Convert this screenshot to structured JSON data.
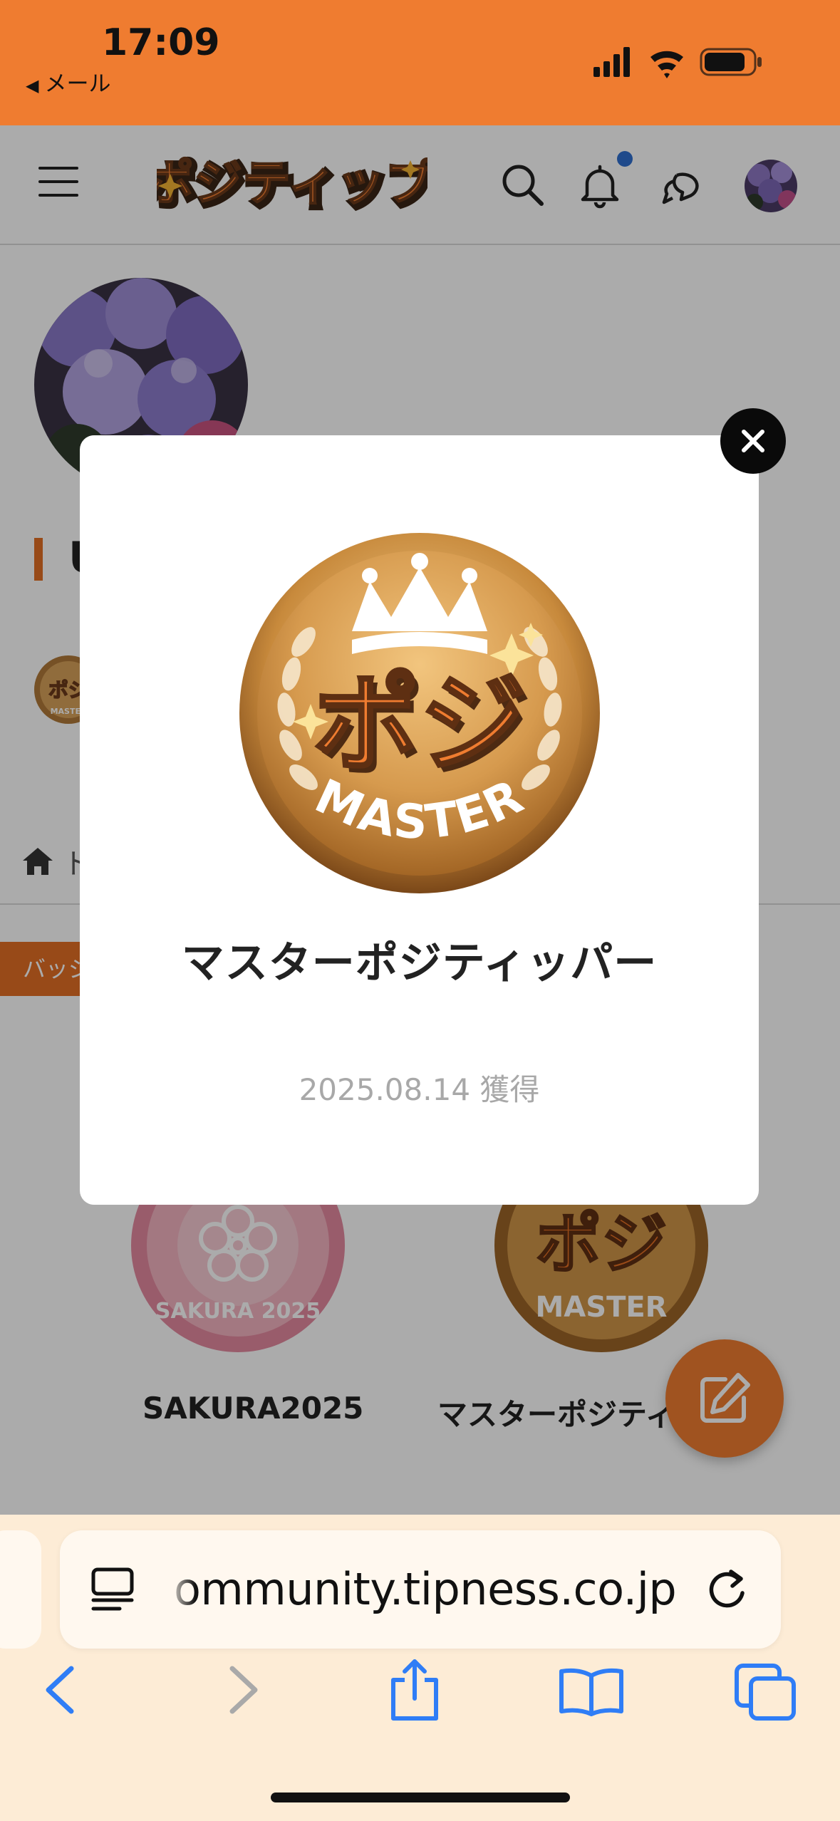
{
  "status_bar": {
    "time": "17:09",
    "back_label": "メール",
    "back_glyph": "◀",
    "icons": [
      "signal-icon",
      "wifi-icon",
      "battery-icon"
    ],
    "color": "#ef7c30"
  },
  "header": {
    "logo_text": "ポジティップ",
    "icons": [
      "menu-icon",
      "search-icon",
      "bell-icon",
      "chat-icon",
      "avatar"
    ],
    "has_notification": true
  },
  "profile": {
    "name_initial": "U",
    "breadcrumb_partial": "ト"
  },
  "tabs": {
    "badge_tab_partial": "バッジ"
  },
  "badge_grid": [
    {
      "label": "SAKURA2025",
      "badge_text": "SAKURA 2025"
    },
    {
      "label": "マスターポジティ"
    }
  ],
  "modal": {
    "badge_logo_text": "ポジ",
    "badge_ribbon_text": "MASTER",
    "title": "マスターポジティッパー",
    "date": "2025.08.14",
    "acquired_label": "獲得",
    "close_glyph": "×"
  },
  "browser": {
    "url": "ommunity.tipness.co.jp",
    "toolbar": [
      "back-icon",
      "forward-icon",
      "share-icon",
      "bookmarks-icon",
      "tabs-icon"
    ]
  },
  "colors": {
    "accent": "#ef7c30",
    "gold": "#c98a3a",
    "sakura": "#e7a0ae",
    "link_blue": "#2f7df6"
  }
}
